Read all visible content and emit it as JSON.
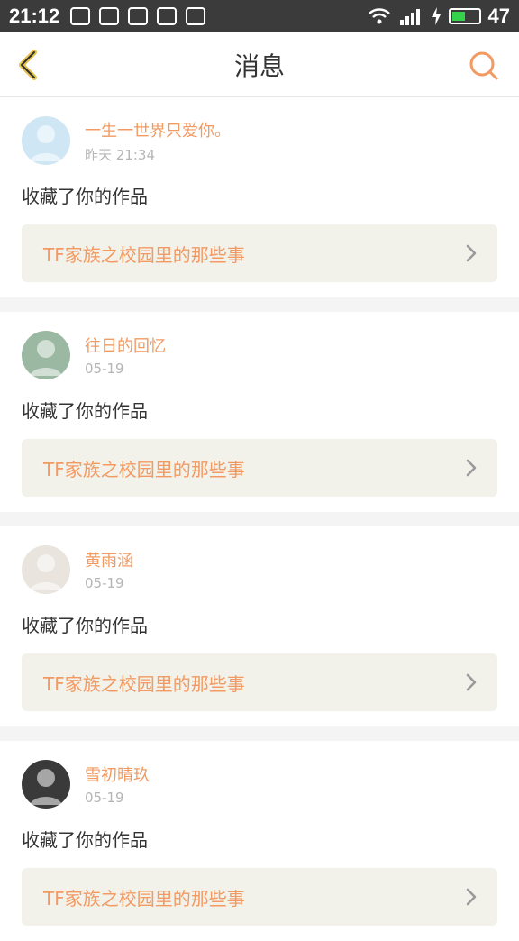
{
  "status": {
    "time": "21:12",
    "battery": "47",
    "icons": [
      "paw-icon",
      "walk-icon",
      "image-icon",
      "weibo-icon",
      "music-icon"
    ]
  },
  "header": {
    "title": "消息",
    "back_icon": "back-chevron-icon",
    "search_icon": "search-icon"
  },
  "items": [
    {
      "name": "一生一世界只爱你。",
      "time": "昨天 21:34",
      "action": "收藏了你的作品",
      "work": "TF家族之校园里的那些事",
      "avatar_color": "#cfe6f5"
    },
    {
      "name": "往日的回忆",
      "time": "05-19",
      "action": "收藏了你的作品",
      "work": "TF家族之校园里的那些事",
      "avatar_color": "#9bb8a2"
    },
    {
      "name": "黄雨涵",
      "time": "05-19",
      "action": "收藏了你的作品",
      "work": "TF家族之校园里的那些事",
      "avatar_color": "#e9e4de"
    },
    {
      "name": "雪初晴玖",
      "time": "05-19",
      "action": "收藏了你的作品",
      "work": "TF家族之校园里的那些事",
      "avatar_color": "#3a3a3a"
    }
  ],
  "colors": {
    "accent": "#f29a62",
    "card_bg": "#f2f2ea"
  }
}
